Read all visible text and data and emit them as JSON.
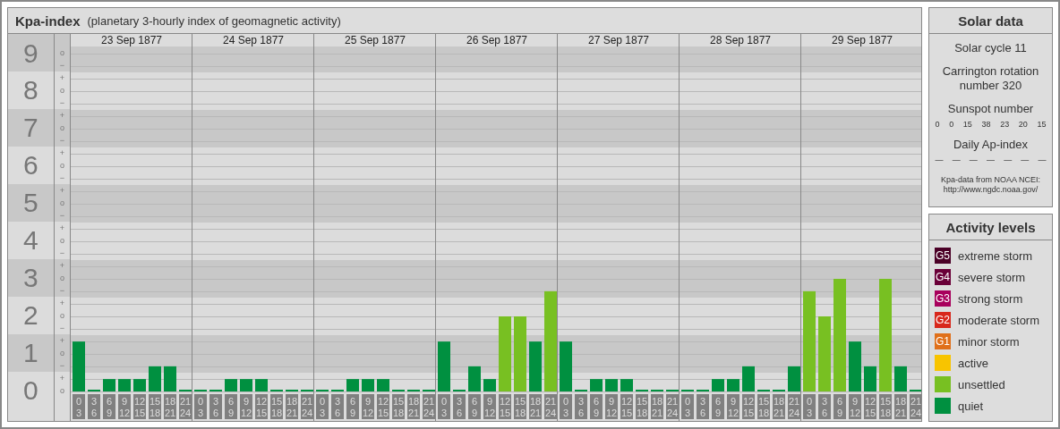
{
  "kpa_panel": {
    "title": "Kpa-index",
    "subtitle": "(planetary 3-hourly index of geomagnetic activity)",
    "y_axis": [
      {
        "label": "9",
        "marks": {
          "mid": "o",
          "minus": "−"
        }
      },
      {
        "label": "8",
        "marks": {
          "plus": "+",
          "mid": "o",
          "minus": "−"
        }
      },
      {
        "label": "7",
        "marks": {
          "plus": "+",
          "mid": "o",
          "minus": "−"
        }
      },
      {
        "label": "6",
        "marks": {
          "plus": "+",
          "mid": "o",
          "minus": "−"
        }
      },
      {
        "label": "5",
        "marks": {
          "plus": "+",
          "mid": "o",
          "minus": "−"
        }
      },
      {
        "label": "4",
        "marks": {
          "plus": "+",
          "mid": "o",
          "minus": "−"
        }
      },
      {
        "label": "3",
        "marks": {
          "plus": "+",
          "mid": "o",
          "minus": "−"
        }
      },
      {
        "label": "2",
        "marks": {
          "plus": "+",
          "mid": "o",
          "minus": "−"
        }
      },
      {
        "label": "1",
        "marks": {
          "plus": "+",
          "mid": "o",
          "minus": "−"
        }
      },
      {
        "label": "0",
        "marks": {
          "plus": "+",
          "mid": "o"
        }
      }
    ],
    "days": [
      {
        "date": "23 Sep 1877",
        "slots": [
          {
            "start": "0",
            "end": "3"
          },
          {
            "start": "3",
            "end": "6"
          },
          {
            "start": "6",
            "end": "9"
          },
          {
            "start": "9",
            "end": "12"
          },
          {
            "start": "12",
            "end": "15"
          },
          {
            "start": "15",
            "end": "18"
          },
          {
            "start": "18",
            "end": "21"
          },
          {
            "start": "21",
            "end": "24"
          }
        ]
      },
      {
        "date": "24 Sep 1877",
        "slots": [
          {
            "start": "0",
            "end": "3"
          },
          {
            "start": "3",
            "end": "6"
          },
          {
            "start": "6",
            "end": "9"
          },
          {
            "start": "9",
            "end": "12"
          },
          {
            "start": "12",
            "end": "15"
          },
          {
            "start": "15",
            "end": "18"
          },
          {
            "start": "18",
            "end": "21"
          },
          {
            "start": "21",
            "end": "24"
          }
        ]
      },
      {
        "date": "25 Sep 1877",
        "slots": [
          {
            "start": "0",
            "end": "3"
          },
          {
            "start": "3",
            "end": "6"
          },
          {
            "start": "6",
            "end": "9"
          },
          {
            "start": "9",
            "end": "12"
          },
          {
            "start": "12",
            "end": "15"
          },
          {
            "start": "15",
            "end": "18"
          },
          {
            "start": "18",
            "end": "21"
          },
          {
            "start": "21",
            "end": "24"
          }
        ]
      },
      {
        "date": "26 Sep 1877",
        "slots": [
          {
            "start": "0",
            "end": "3"
          },
          {
            "start": "3",
            "end": "6"
          },
          {
            "start": "6",
            "end": "9"
          },
          {
            "start": "9",
            "end": "12"
          },
          {
            "start": "12",
            "end": "15"
          },
          {
            "start": "15",
            "end": "18"
          },
          {
            "start": "18",
            "end": "21"
          },
          {
            "start": "21",
            "end": "24"
          }
        ]
      },
      {
        "date": "27 Sep 1877",
        "slots": [
          {
            "start": "0",
            "end": "3"
          },
          {
            "start": "3",
            "end": "6"
          },
          {
            "start": "6",
            "end": "9"
          },
          {
            "start": "9",
            "end": "12"
          },
          {
            "start": "12",
            "end": "15"
          },
          {
            "start": "15",
            "end": "18"
          },
          {
            "start": "18",
            "end": "21"
          },
          {
            "start": "21",
            "end": "24"
          }
        ]
      },
      {
        "date": "28 Sep 1877",
        "slots": [
          {
            "start": "0",
            "end": "3"
          },
          {
            "start": "3",
            "end": "6"
          },
          {
            "start": "6",
            "end": "9"
          },
          {
            "start": "9",
            "end": "12"
          },
          {
            "start": "12",
            "end": "15"
          },
          {
            "start": "15",
            "end": "18"
          },
          {
            "start": "18",
            "end": "21"
          },
          {
            "start": "21",
            "end": "24"
          }
        ]
      },
      {
        "date": "29 Sep 1877",
        "slots": [
          {
            "start": "0",
            "end": "3"
          },
          {
            "start": "3",
            "end": "6"
          },
          {
            "start": "6",
            "end": "9"
          },
          {
            "start": "9",
            "end": "12"
          },
          {
            "start": "12",
            "end": "15"
          },
          {
            "start": "15",
            "end": "18"
          },
          {
            "start": "18",
            "end": "21"
          },
          {
            "start": "21",
            "end": "24"
          }
        ]
      }
    ],
    "chart_data": {
      "type": "bar",
      "grid": true,
      "ylim": [
        0,
        9
      ],
      "yticks": [
        0,
        1,
        2,
        3,
        4,
        5,
        6,
        7,
        8,
        9
      ],
      "values": [
        1.33,
        0,
        0.33,
        0.33,
        0.33,
        0.67,
        0.67,
        0,
        0,
        0,
        0.33,
        0.33,
        0.33,
        0,
        0,
        0,
        0,
        0,
        0.33,
        0.33,
        0.33,
        0,
        0,
        0,
        1.33,
        0,
        0.67,
        0.33,
        2,
        2,
        1.33,
        2.67,
        1.33,
        0,
        0.33,
        0.33,
        0.33,
        0,
        0,
        0,
        0,
        0,
        0.33,
        0.33,
        0.67,
        0,
        0,
        0.67,
        2.67,
        2,
        3,
        1.33,
        0.67,
        3,
        0.67,
        0
      ]
    }
  },
  "solar_data": {
    "title": "Solar data",
    "solar_cycle": "Solar cycle 11",
    "carrington": "Carrington rotation number 320",
    "sunspot_title": "Sunspot number",
    "sunspot_numbers": [
      "0",
      "0",
      "15",
      "38",
      "23",
      "20",
      "15"
    ],
    "ap_title": "Daily Ap-index",
    "ap_values": [
      "—",
      "—",
      "—",
      "—",
      "—",
      "—",
      "—"
    ],
    "source": "Kpa-data from NOAA NCEI:",
    "source_url": "http://www.ngdc.noaa.gov/"
  },
  "activity_levels": {
    "title": "Activity levels",
    "items": [
      {
        "badge": "G5",
        "label": "extreme storm",
        "color": "#4a0026"
      },
      {
        "badge": "G4",
        "label": "severe storm",
        "color": "#6a0038"
      },
      {
        "badge": "G3",
        "label": "strong storm",
        "color": "#a8005c"
      },
      {
        "badge": "G2",
        "label": "moderate storm",
        "color": "#d8281c"
      },
      {
        "badge": "G1",
        "label": "minor storm",
        "color": "#e0701a"
      },
      {
        "label": "active",
        "color": "#f8c400"
      },
      {
        "label": "unsettled",
        "color": "#78c022"
      },
      {
        "label": "quiet",
        "color": "#009040"
      }
    ]
  }
}
